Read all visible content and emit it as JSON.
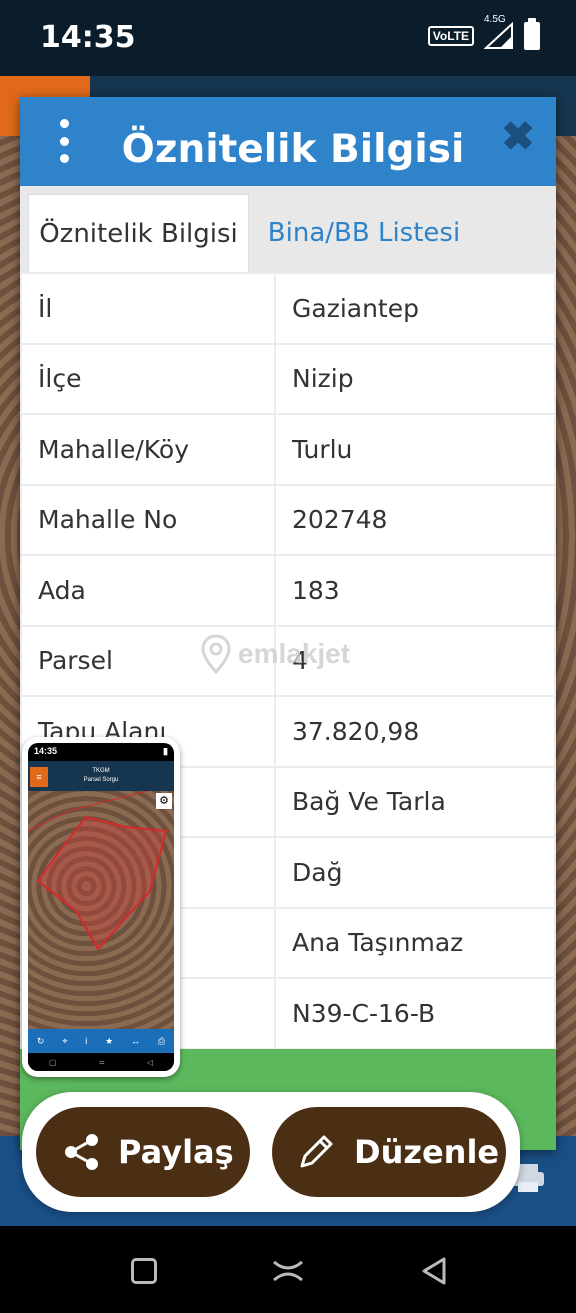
{
  "status_bar": {
    "time": "14:35",
    "volte": "VoLTE",
    "network": "4.5G"
  },
  "dialog": {
    "title": "Öznitelik Bilgisi",
    "close": "✖",
    "tabs": [
      {
        "label": "Öznitelik Bilgisi",
        "active": true
      },
      {
        "label": "Bina/BB Listesi",
        "active": false
      }
    ],
    "rows": [
      {
        "key": "İl",
        "value": "Gaziantep"
      },
      {
        "key": "İlçe",
        "value": "Nizip"
      },
      {
        "key": "Mahalle/Köy",
        "value": "Turlu"
      },
      {
        "key": "Mahalle No",
        "value": "202748"
      },
      {
        "key": "Ada",
        "value": "183"
      },
      {
        "key": "Parsel",
        "value": "4"
      },
      {
        "key": "Tapu Alanı",
        "value": "37.820,98"
      },
      {
        "key": "",
        "value": "Bağ Ve Tarla"
      },
      {
        "key": "",
        "value": "Dağ"
      },
      {
        "key": "",
        "value": "Ana Taşınmaz"
      },
      {
        "key": "",
        "value": "N39-C-16-B"
      }
    ]
  },
  "watermark": "emlakjet",
  "mini_phone": {
    "time": "14:35",
    "header_line1": "TKGM",
    "header_line2": "Parsel Sorgu"
  },
  "actions": {
    "share_label": "Paylaş",
    "edit_label": "Düzenle"
  },
  "colors": {
    "header_blue": "#2e83cb",
    "button_brown": "#4a2f15",
    "green": "#5cb85c"
  }
}
